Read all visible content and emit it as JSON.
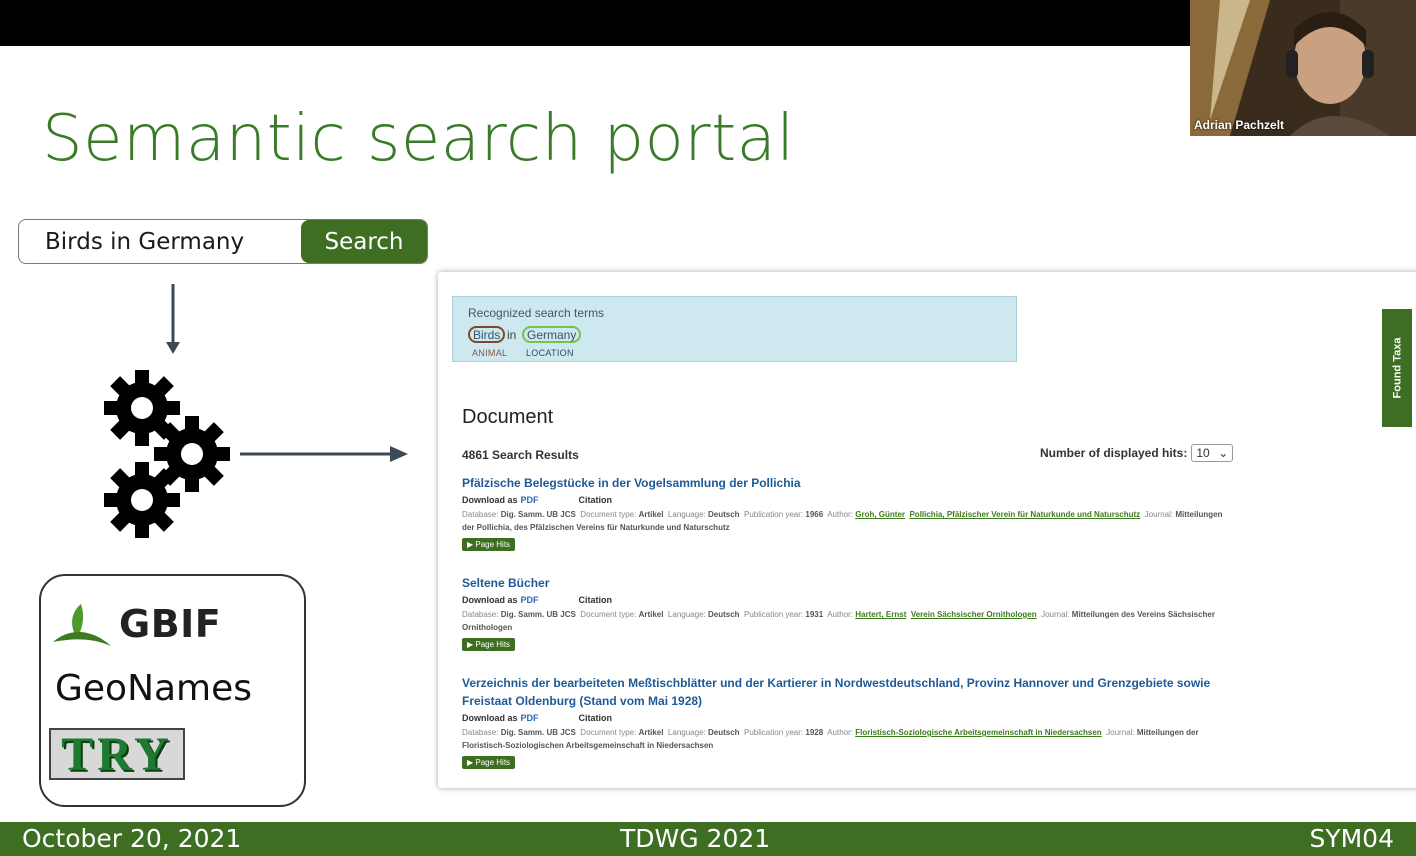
{
  "slide": {
    "title": "Semantic search portal",
    "search": {
      "query": "Birds in Germany",
      "button": "Search"
    },
    "sources": {
      "gbif": "GBIF",
      "geonames": "GeoNames",
      "try": "TRY"
    }
  },
  "portal": {
    "recognized_title": "Recognized search terms",
    "terms": [
      {
        "text": "Birds",
        "tag": "ANIMAL"
      },
      {
        "text": "Germany",
        "tag": "LOCATION"
      }
    ],
    "connector": "in",
    "section_title": "Document",
    "result_count": "4861 Search Results",
    "hits_label": "Number of displayed hits:",
    "hits_value": "10",
    "found_taxa": "Found Taxa",
    "download_as": "Download as",
    "pdf": "PDF",
    "citation": "Citation",
    "page_hits": "▶ Page Hits",
    "results": [
      {
        "title": "Pfälzische Belegstücke in der Vogelsammlung der Pollichia",
        "database": "Dig. Samm. UB JCS",
        "doctype": "Artikel",
        "language": "Deutsch",
        "year": "1966",
        "author": "Groh, Günter",
        "publisher": "Pollichia, Pfälzischer Verein für Naturkunde und Naturschutz",
        "journal": "Mitteilungen der Pollichia, des Pfälzischen Vereins für Naturkunde und Naturschutz"
      },
      {
        "title": "Seltene Bücher",
        "database": "Dig. Samm. UB JCS",
        "doctype": "Artikel",
        "language": "Deutsch",
        "year": "1931",
        "author": "Hartert, Ernst",
        "publisher": "Verein Sächsischer Ornithologen",
        "journal": "Mitteilungen des Vereins Sächsischer Ornithologen"
      },
      {
        "title": "Verzeichnis der bearbeiteten Meßtischblätter und der Kartierer in Nordwestdeutschland, Provinz Hannover und Grenzgebiete sowie Freistaat Oldenburg (Stand vom Mai 1928)",
        "database": "Dig. Samm. UB JCS",
        "doctype": "Artikel",
        "language": "Deutsch",
        "year": "1928",
        "author": "Floristisch-Soziologische Arbeitsgemeinschaft in Niedersachsen",
        "publisher": "",
        "journal": "Mitteilungen der Floristisch-Soziologischen Arbeitsgemeinschaft in Niedersachsen"
      }
    ],
    "meta_labels": {
      "database": "Database:",
      "doctype": "Document type:",
      "language": "Language:",
      "year": "Publication year:",
      "author": "Author:",
      "journal": "Journal:"
    }
  },
  "footer": {
    "date": "October 20, 2021",
    "event": "TDWG 2021",
    "session": "SYM04"
  },
  "camera": {
    "name": "Adrian Pachzelt"
  },
  "colors": {
    "green": "#3e6e22",
    "title_green": "#3a7a2a",
    "link_blue": "#1f5a96",
    "recognized_bg": "#cde8ee"
  }
}
